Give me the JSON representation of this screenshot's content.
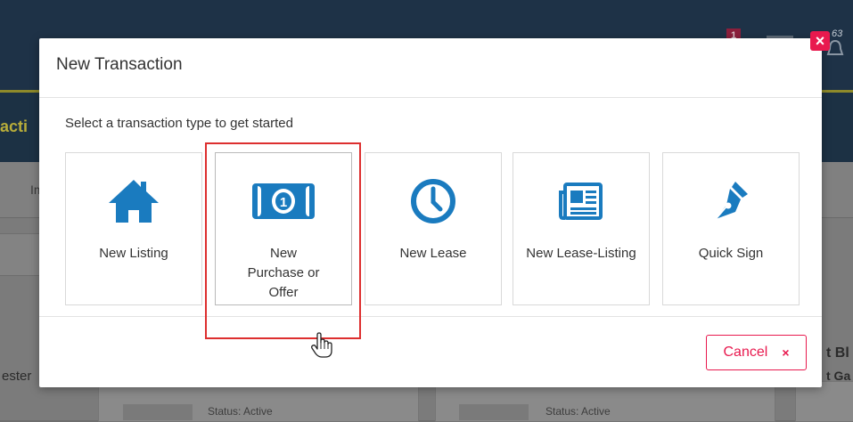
{
  "background": {
    "nav_partial": "acti",
    "toolbar_partial": "Im",
    "left_partial": "ester",
    "status_1": "Status: Active",
    "status_2": "Status: Active",
    "right_partial_1": "t Bl",
    "right_partial_2": "t Ga",
    "badge_count": "1",
    "notification_count": "63"
  },
  "modal": {
    "title": "New Transaction",
    "subtitle": "Select a transaction type to get started",
    "tiles": [
      {
        "label": "New Listing",
        "icon": "home-icon"
      },
      {
        "label": "New Purchase or Offer",
        "icon": "money-bill-icon"
      },
      {
        "label": "New Lease",
        "icon": "clock-icon"
      },
      {
        "label": "New Lease-Listing",
        "icon": "newspaper-icon"
      },
      {
        "label": "Quick Sign",
        "icon": "pen-nib-icon"
      }
    ],
    "cancel_label": "Cancel",
    "cancel_icon": "×",
    "close_icon": "×",
    "accent_color": "#1a7bbf",
    "cancel_color": "#e8194e",
    "highlight_color": "#dd2f2f"
  }
}
